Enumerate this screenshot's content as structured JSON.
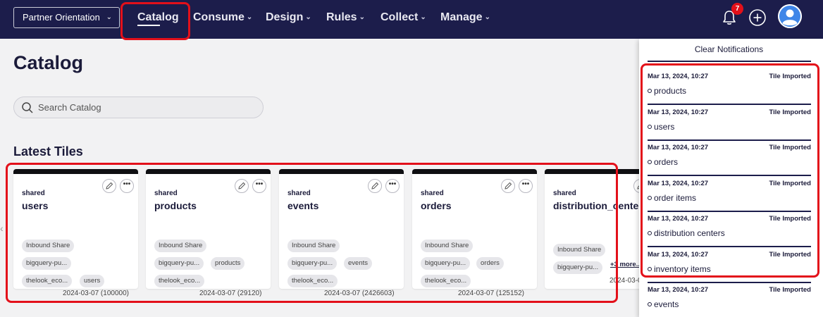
{
  "nav": {
    "org_select": "Partner Orientation",
    "items": [
      {
        "label": "Catalog"
      },
      {
        "label": "Consume"
      },
      {
        "label": "Design"
      },
      {
        "label": "Rules"
      },
      {
        "label": "Collect"
      },
      {
        "label": "Manage"
      }
    ],
    "notification_count": "7"
  },
  "page": {
    "title": "Catalog",
    "search_placeholder": "Search Catalog",
    "section_title": "Latest Tiles"
  },
  "tiles": [
    {
      "type": "shared",
      "name": "users",
      "chips": [
        "Inbound Share",
        "bigquery-pu...",
        "thelook_eco...",
        "users"
      ],
      "date": "2024-03-07 (100000)"
    },
    {
      "type": "shared",
      "name": "products",
      "chips": [
        "Inbound Share",
        "bigquery-pu...",
        "products",
        "thelook_eco..."
      ],
      "date": "2024-03-07 (29120)"
    },
    {
      "type": "shared",
      "name": "events",
      "chips": [
        "Inbound Share",
        "bigquery-pu...",
        "events",
        "thelook_eco..."
      ],
      "date": "2024-03-07 (2426603)"
    },
    {
      "type": "shared",
      "name": "orders",
      "chips": [
        "Inbound Share",
        "bigquery-pu...",
        "orders",
        "thelook_eco..."
      ],
      "date": "2024-03-07 (125152)"
    },
    {
      "type": "shared",
      "name": "distribution_centers",
      "chips": [
        "Inbound Share",
        "bigquery-pu..."
      ],
      "more": "+3 more..",
      "date": "2024-03-0"
    }
  ],
  "notifications": {
    "clear_label": "Clear Notifications",
    "items": [
      {
        "time": "Mar 13, 2024, 10:27",
        "kind": "Tile Imported",
        "item": "products"
      },
      {
        "time": "Mar 13, 2024, 10:27",
        "kind": "Tile Imported",
        "item": "users"
      },
      {
        "time": "Mar 13, 2024, 10:27",
        "kind": "Tile Imported",
        "item": "orders"
      },
      {
        "time": "Mar 13, 2024, 10:27",
        "kind": "Tile Imported",
        "item": "order items"
      },
      {
        "time": "Mar 13, 2024, 10:27",
        "kind": "Tile Imported",
        "item": "distribution centers"
      },
      {
        "time": "Mar 13, 2024, 10:27",
        "kind": "Tile Imported",
        "item": "inventory items"
      },
      {
        "time": "Mar 13, 2024, 10:27",
        "kind": "Tile Imported",
        "item": "events"
      }
    ]
  },
  "colors": {
    "nav_bg": "#1c1d4b",
    "highlight": "#e3101a",
    "badge": "#e3101a"
  }
}
